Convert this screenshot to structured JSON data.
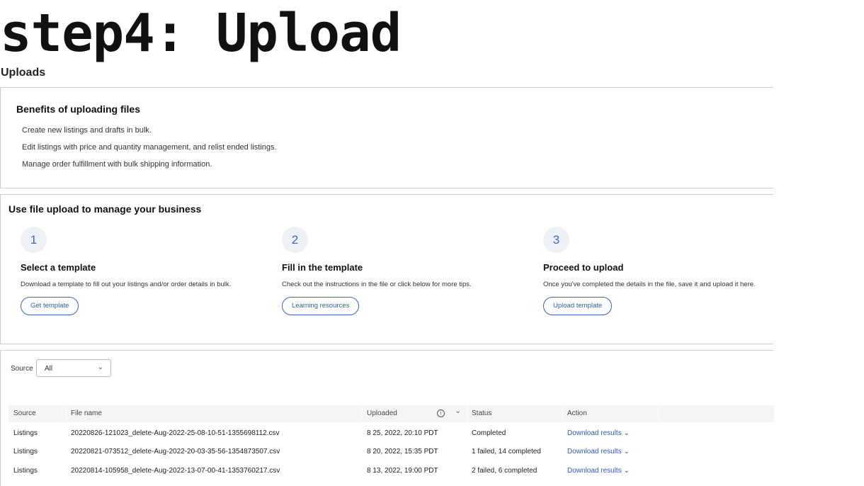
{
  "slide_title": "step4: Upload",
  "page_heading": "Uploads",
  "benefits": {
    "title": "Benefits of uploading files",
    "items": [
      "Create new listings and drafts in bulk.",
      "Edit listings with price and quantity management, and relist ended listings.",
      "Manage order fulfillment with bulk shipping information."
    ]
  },
  "howto": {
    "title": "Use file upload to manage your business",
    "steps": [
      {
        "number": "1",
        "title": "Select a template",
        "description": "Download a template to fill out your listings and/or order details in bulk.",
        "button": "Get template"
      },
      {
        "number": "2",
        "title": "Fill in the template",
        "description": "Check out the instructions in the file or click below for more tips.",
        "button": "Learning resources"
      },
      {
        "number": "3",
        "title": "Proceed to upload",
        "description": "Once you've completed the details in the file, save it and upload it here.",
        "button": "Upload template"
      }
    ]
  },
  "filter": {
    "label": "Source",
    "value": "All"
  },
  "table": {
    "headers": {
      "source": "Source",
      "file_name": "File name",
      "uploaded": "Uploaded",
      "status": "Status",
      "action": "Action"
    },
    "rows": [
      {
        "source": "Listings",
        "file_name": "20220826-121023_delete-Aug-2022-25-08-10-51-1355698112.csv",
        "uploaded": "8 25, 2022, 20:10 PDT",
        "status": "Completed",
        "action": "Download results"
      },
      {
        "source": "Listings",
        "file_name": "20220821-073512_delete-Aug-2022-20-03-35-56-1354873507.csv",
        "uploaded": "8 20, 2022, 15:35 PDT",
        "status": "1 failed, 14 completed",
        "action": "Download results"
      },
      {
        "source": "Listings",
        "file_name": "20220814-105958_delete-Aug-2022-13-07-00-41-1353760217.csv",
        "uploaded": "8 13, 2022, 19:00 PDT",
        "status": "2 failed, 6 completed",
        "action": "Download results"
      }
    ]
  },
  "colors": {
    "accent": "#3665f3",
    "link": "#2f58c4",
    "header_bg": "#f5f5f5",
    "border": "#cfcfcf"
  }
}
